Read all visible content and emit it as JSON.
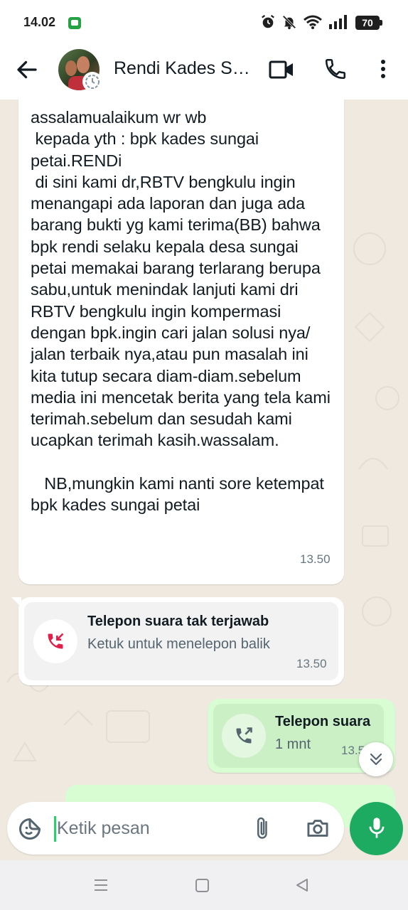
{
  "status_bar": {
    "time": "14.02",
    "battery": "70",
    "icons": [
      "alarm-icon",
      "bell-off-icon",
      "wifi-icon",
      "signal-icon",
      "battery-icon"
    ]
  },
  "header": {
    "contact_name": "Rendi Kades S…",
    "icons": [
      "back-arrow-icon",
      "video-call-icon",
      "phone-icon",
      "more-vert-icon"
    ]
  },
  "messages": [
    {
      "direction": "incoming",
      "text": "assalamualaikum wr wb\n kepada yth : bpk kades sungai petai.RENDi\n di sini kami dr,RBTV bengkulu ingin menangapi ada laporan dan juga ada barang bukti yg kami terima(BB) bahwa bpk rendi selaku kepala desa sungai petai memakai barang terlarang berupa sabu,untuk menindak lanjuti kami dri RBTV bengkulu ingin kompermasi dengan bpk.ingin cari jalan solusi nya/ jalan terbaik nya,atau pun masalah ini kita tutup secara diam-diam.sebelum media ini mencetak berita yang tela kami terimah.sebelum dan sesudah kami ucapkan terimah kasih.wassalam.\n\n   NB,mungkin kami nanti sore ketempat bpk kades sungai petai",
      "time": "13.50"
    },
    {
      "direction": "incoming",
      "type": "missed_call",
      "title": "Telepon suara tak terjawab",
      "subtitle": "Ketuk untuk menelepon balik",
      "time": "13.50"
    },
    {
      "direction": "outgoing",
      "type": "voice_call",
      "title": "Telepon suara",
      "subtitle": "1 mnt",
      "time": "13.55"
    }
  ],
  "composer": {
    "placeholder": "Ketik pesan"
  },
  "colors": {
    "chat_bg": "#efe9e0",
    "outgoing_bubble": "#d8fdd2",
    "incoming_bubble": "#ffffff",
    "accent_green": "#1daa61",
    "missed_call_red": "#e0204a"
  }
}
